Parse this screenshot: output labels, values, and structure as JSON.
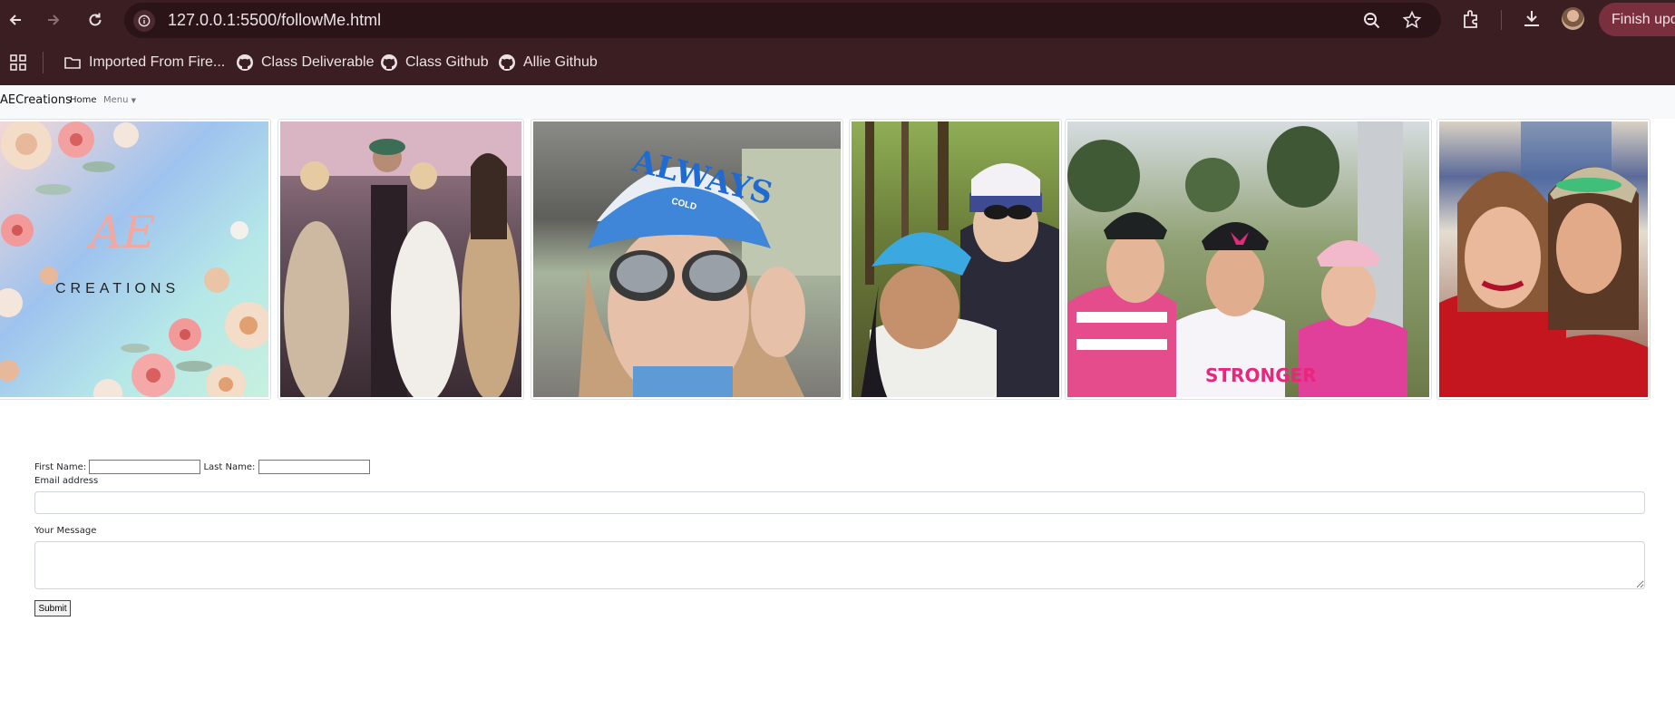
{
  "browser": {
    "url": "127.0.0.1:5500/followMe.html",
    "finish_update_label": "Finish upda",
    "bookmarks": [
      {
        "label": "Imported From Fire...",
        "icon": "folder-icon"
      },
      {
        "label": "Class Deliverable",
        "icon": "github-icon"
      },
      {
        "label": "Class Github",
        "icon": "github-icon"
      },
      {
        "label": "Allie Github",
        "icon": "github-icon"
      }
    ],
    "colors": {
      "frame": "#3b1e22",
      "omnibox": "#2a1417",
      "accent": "#7a2f3f"
    }
  },
  "navbar": {
    "brand": "AECreations",
    "home": "Home",
    "menu": "Menu"
  },
  "gallery": {
    "logo_mark": "AE",
    "logo_text": "CREATIONS",
    "hat_text_1": "ALWAYS",
    "hat_text_2": "COLD",
    "shirt_text": "STRONGER"
  },
  "form": {
    "first_name_label": "First Name:",
    "last_name_label": "Last Name:",
    "email_label": "Email address",
    "message_label": "Your Message",
    "submit_label": "Submit",
    "first_name_value": "",
    "last_name_value": "",
    "email_value": "",
    "message_value": ""
  }
}
